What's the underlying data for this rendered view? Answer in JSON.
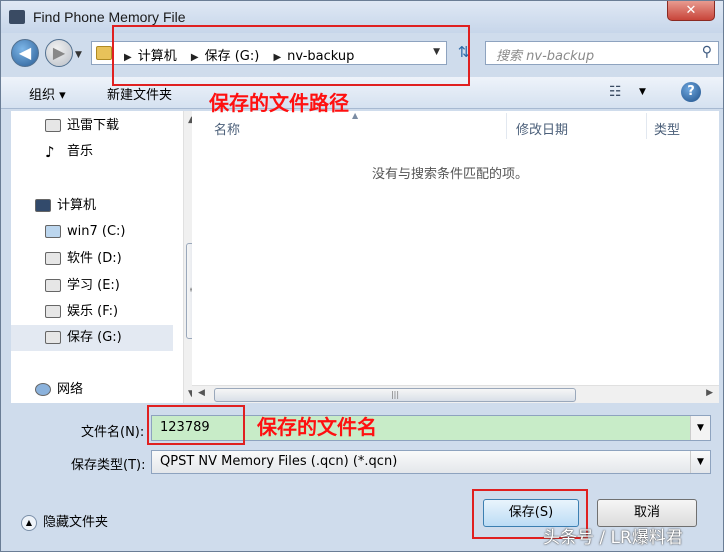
{
  "window": {
    "title": "Find Phone Memory File",
    "close_label": "✕"
  },
  "nav": {
    "breadcrumbs": [
      "计算机",
      "保存 (G:)",
      "nv-backup"
    ],
    "search_placeholder": "搜索 nv-backup"
  },
  "toolbar": {
    "organize_label": "组织 ▾",
    "new_folder_label": "新建文件夹"
  },
  "sidebar": {
    "items": [
      {
        "label": "迅雷下载",
        "icon": "download-folder-icon"
      },
      {
        "label": "音乐",
        "icon": "music-icon"
      },
      {
        "label": "计算机",
        "icon": "computer-icon"
      },
      {
        "label": "win7 (C:)",
        "icon": "system-drive-icon"
      },
      {
        "label": "软件 (D:)",
        "icon": "drive-icon"
      },
      {
        "label": "学习 (E:)",
        "icon": "drive-icon"
      },
      {
        "label": "娱乐 (F:)",
        "icon": "drive-icon"
      },
      {
        "label": "保存 (G:)",
        "icon": "drive-icon",
        "selected": true
      },
      {
        "label": "网络",
        "icon": "network-icon"
      }
    ]
  },
  "filelist": {
    "columns": [
      "名称",
      "修改日期",
      "类型"
    ],
    "empty_message": "没有与搜索条件匹配的项。"
  },
  "form": {
    "filename_label": "文件名(N):",
    "filename_value": "123789",
    "filetype_label": "保存类型(T):",
    "filetype_value": "QPST NV Memory Files (.qcn) (*.qcn)"
  },
  "footer": {
    "hide_folders_label": "隐藏文件夹",
    "save_label": "保存(S)",
    "cancel_label": "取消"
  },
  "annotations": {
    "path_note": "保存的文件路径",
    "filename_note": "保存的文件名",
    "highlight_color": "#e02020"
  },
  "watermark": "头条号 / LR爆料君"
}
